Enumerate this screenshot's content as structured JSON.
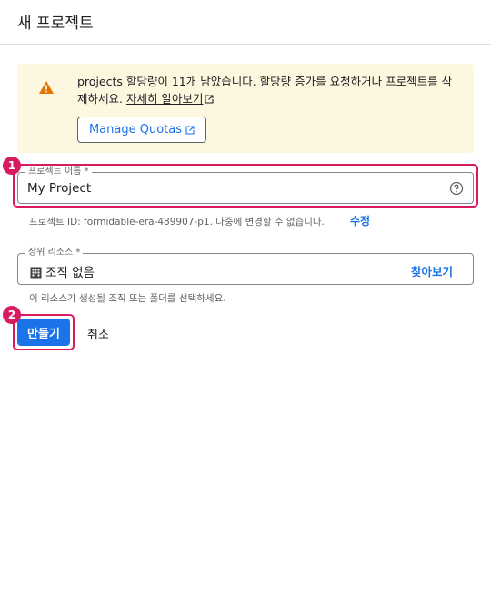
{
  "header": {
    "title": "새 프로젝트"
  },
  "warning": {
    "text": "projects 할당량이 11개 남았습니다. 할당량 증가를 요청하거나 프로젝트를 삭제하세요.",
    "learn_more": "자세히 알아보기",
    "manage_quotas": "Manage Quotas",
    "icon": "warning-icon",
    "icon_color": "#e37400"
  },
  "markers": {
    "first": "1",
    "second": "2",
    "color": "#d81b60"
  },
  "project_name": {
    "label": "프로젝트 이름 *",
    "value": "My Project",
    "icon": "help-icon",
    "helper": "프로젝트 ID: formidable-era-489907-p1. 나중에 변경할 수 없습니다.",
    "edit": "수정"
  },
  "parent_resource": {
    "label": "상위 리소스 *",
    "value": "조직 없음",
    "icon": "organization-icon",
    "browse": "찾아보기",
    "helper": "이 리소스가 생성될 조직 또는 폴더를 선택하세요."
  },
  "actions": {
    "create": "만들기",
    "cancel": "취소"
  },
  "colors": {
    "accent": "#1a73e8",
    "warning_bg": "#fef7e0",
    "highlight": "#d81b60"
  }
}
